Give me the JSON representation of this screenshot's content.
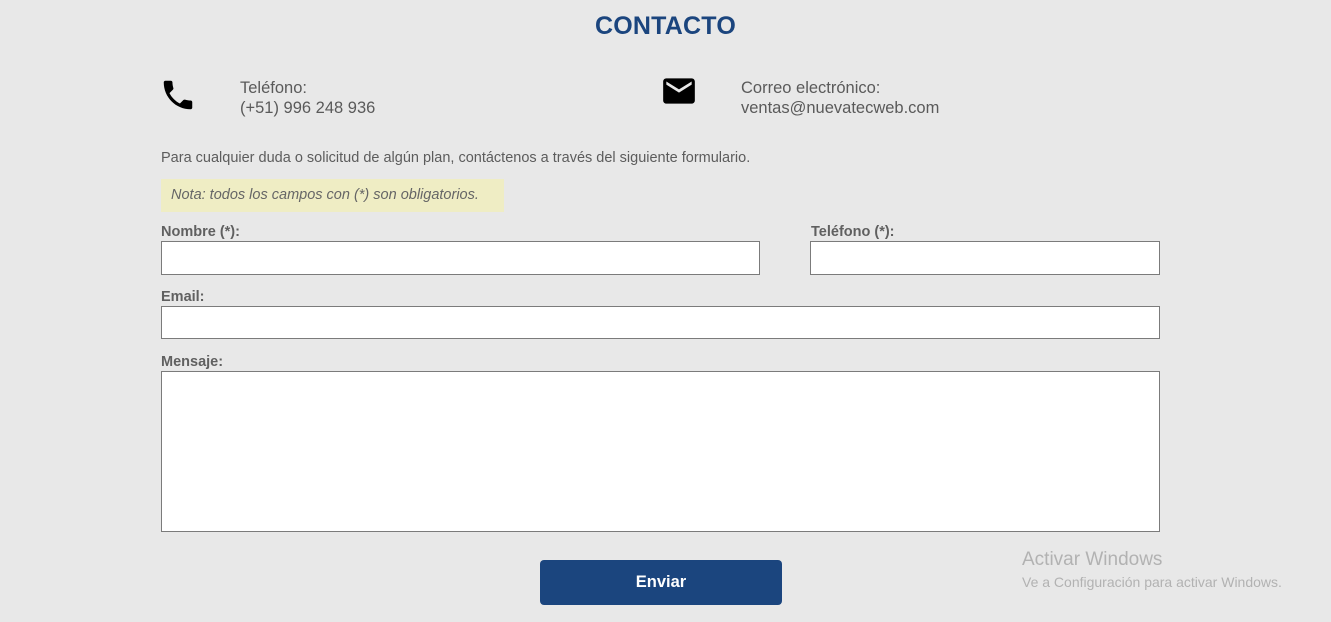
{
  "page": {
    "title": "CONTACTO",
    "accent_color": "#1b457e"
  },
  "contact": {
    "phone": {
      "icon": "phone-icon",
      "label": "Teléfono:",
      "value": "(+51) 996 248 936"
    },
    "email": {
      "icon": "envelope-icon",
      "label": "Correo electrónico:",
      "value": "ventas@nuevatecweb.com"
    }
  },
  "form": {
    "intro": "Para cualquier duda o solicitud de algún plan, contáctenos a través del siguiente formulario.",
    "note": "Nota: todos los campos con (*) son obligatorios.",
    "note_bg_color": "#efedc4",
    "fields": {
      "name": {
        "label": "Nombre (*):",
        "value": ""
      },
      "phone": {
        "label": "Teléfono (*):",
        "value": ""
      },
      "email": {
        "label": "Email:",
        "value": ""
      },
      "message": {
        "label": "Mensaje:",
        "value": ""
      }
    },
    "submit_label": "Enviar"
  },
  "watermark": {
    "title": "Activar Windows",
    "subtitle": "Ve a Configuración para activar Windows."
  }
}
